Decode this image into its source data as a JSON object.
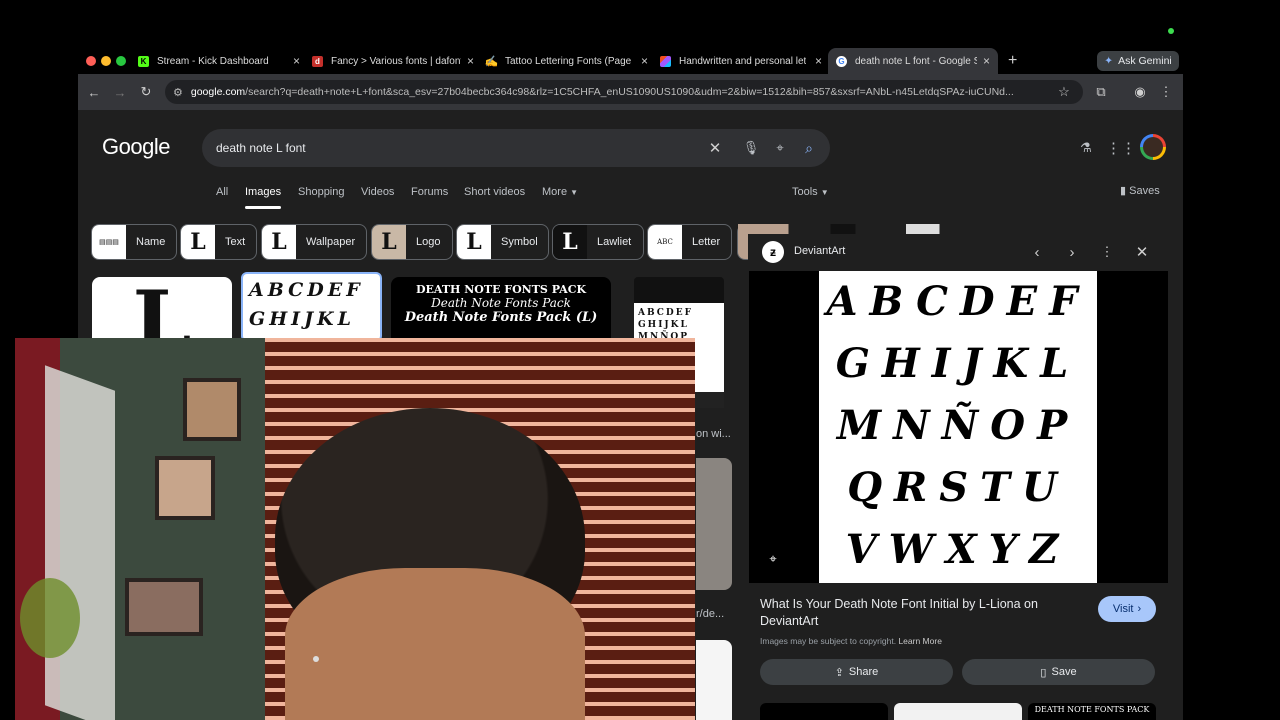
{
  "window": {
    "tabs": [
      {
        "title": "Stream - Kick Dashboard",
        "icon": "kick-icon",
        "color": "#53fc18"
      },
      {
        "title": "Fancy > Various fonts | dafont",
        "icon": "dafont-icon",
        "color": "#c4302b"
      },
      {
        "title": "Tattoo Lettering Fonts (Page",
        "icon": "font-site-icon",
        "color": "#7a6cf5"
      },
      {
        "title": "Handwritten and personal let",
        "icon": "figma-icon",
        "color": "#f24e1e"
      },
      {
        "title": "death note L font - Google Se",
        "icon": "google-icon",
        "color": "#4285f4"
      }
    ],
    "ask_gemini": "Ask Gemini",
    "url_host": "google.com",
    "url_rest": "/search?q=death+note+L+font&sca_esv=27b04becbc364c98&rlz=1C5CHFA_enUS1090US1090&udm=2&biw=1512&bih=857&sxsrf=ANbL-n45LetdqSPAz-iuCUNd..."
  },
  "google": {
    "logo": "Google",
    "query": "death note L font",
    "nav": [
      "All",
      "Images",
      "Shopping",
      "Videos",
      "Forums",
      "Short videos",
      "More"
    ],
    "tools": "Tools",
    "saves": "Saves",
    "chips": [
      "Name",
      "Text",
      "Wallpaper",
      "Logo",
      "Symbol",
      "Lawliet",
      "Letter"
    ],
    "result_texts": {
      "pack_line1": "DEATH NOTE FONTS PACK",
      "pack_line2": "Death Note Fonts Pack",
      "pack_line3": "Death Note Fonts Pack (L)",
      "snippet_a": "on wi...",
      "snippet_b": "r/de..."
    }
  },
  "panel": {
    "source": "DeviantArt",
    "alphabet_rows": [
      "ABCDEF",
      "GHIJKL",
      "MNÑOP",
      "QRSTU",
      "VWXYZ"
    ],
    "title": "What Is Your Death Note Font Initial by L-Liona on DeviantArt",
    "visit": "Visit",
    "copyright": "Images may be subject to copyright.",
    "learn_more": "Learn More",
    "share": "Share",
    "save": "Save",
    "related_pack": "DEATH NOTE FONTS PACK"
  }
}
